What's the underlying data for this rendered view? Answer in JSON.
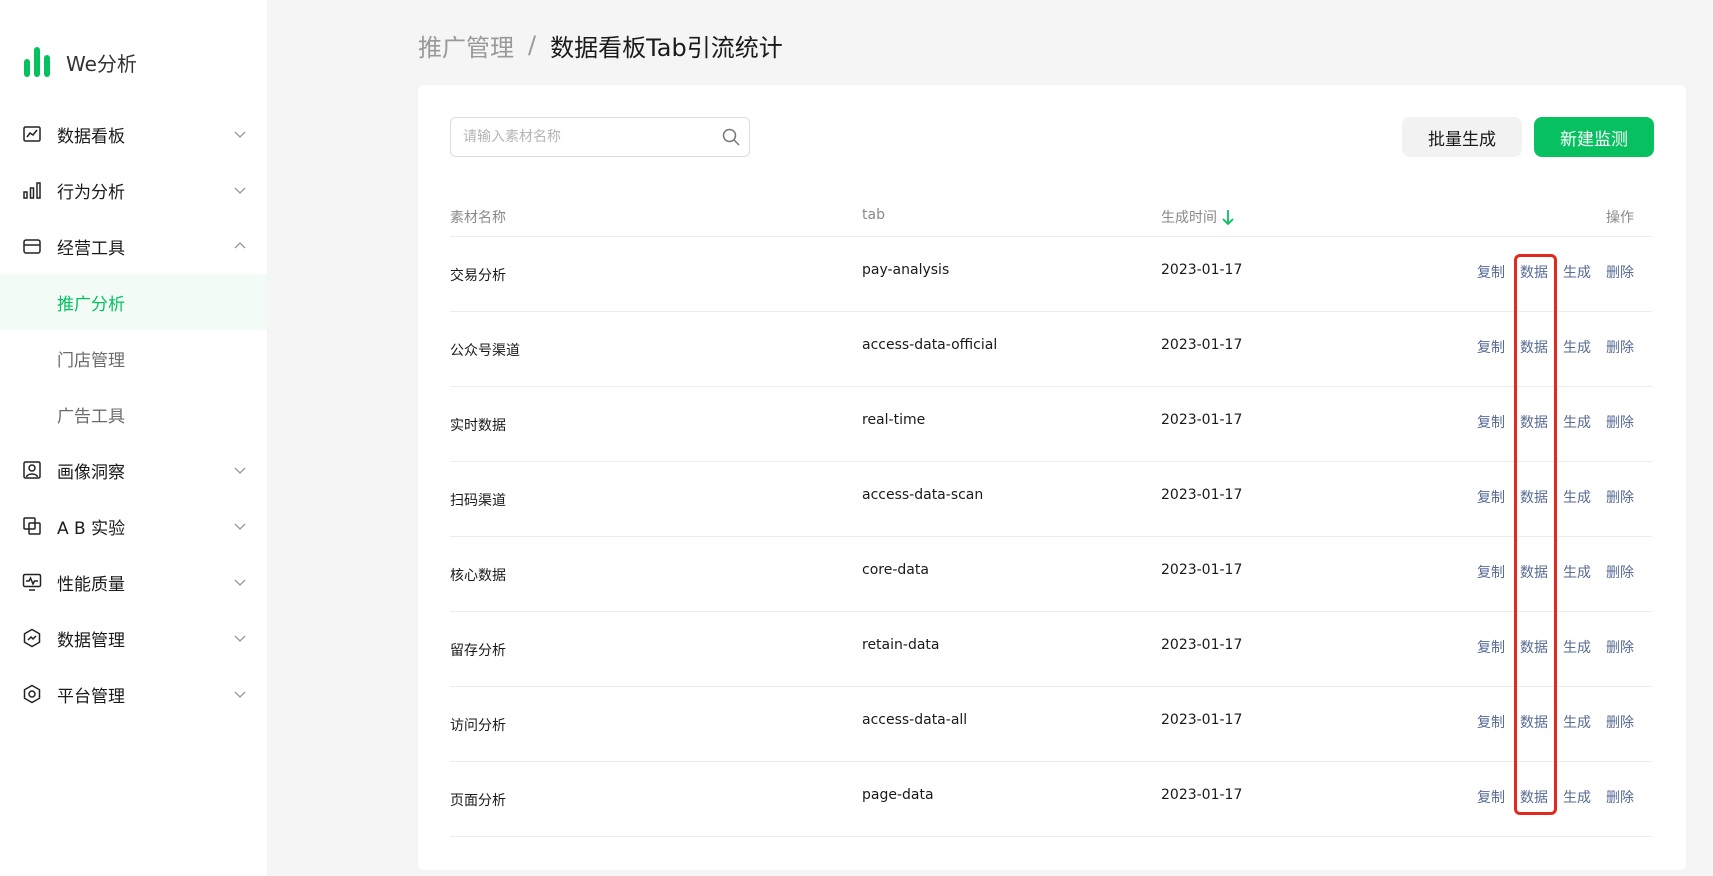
{
  "app": {
    "name": "We分析",
    "brand_color": "#07c160"
  },
  "sidebar": {
    "items": [
      {
        "label": "数据看板",
        "icon": "chart-board-icon",
        "expanded": false
      },
      {
        "label": "行为分析",
        "icon": "bar-chart-icon",
        "expanded": false
      },
      {
        "label": "经营工具",
        "icon": "store-icon",
        "expanded": true,
        "children": [
          {
            "label": "推广分析",
            "active": true
          },
          {
            "label": "门店管理",
            "active": false
          },
          {
            "label": "广告工具",
            "active": false
          }
        ]
      },
      {
        "label": "画像洞察",
        "icon": "portrait-icon",
        "expanded": false
      },
      {
        "label": "A B 实验",
        "icon": "ab-test-icon",
        "expanded": false
      },
      {
        "label": "性能质量",
        "icon": "monitor-icon",
        "expanded": false
      },
      {
        "label": "数据管理",
        "icon": "data-manage-icon",
        "expanded": false
      },
      {
        "label": "平台管理",
        "icon": "platform-gear-icon",
        "expanded": false
      }
    ]
  },
  "breadcrumb": {
    "parent": "推广管理",
    "separator": "/",
    "current": "数据看板Tab引流统计"
  },
  "toolbar": {
    "search_placeholder": "请输入素材名称",
    "batch_label": "批量生成",
    "new_label": "新建监测"
  },
  "table": {
    "headers": {
      "name": "素材名称",
      "tab": "tab",
      "time": "生成时间",
      "ops": "操作"
    },
    "sort": {
      "column": "time",
      "direction": "desc"
    },
    "actions": {
      "copy": "复制",
      "data": "数据",
      "generate": "生成",
      "delete": "删除"
    },
    "rows": [
      {
        "name": "交易分析",
        "tab": "pay-analysis",
        "time": "2023-01-17"
      },
      {
        "name": "公众号渠道",
        "tab": "access-data-official",
        "time": "2023-01-17"
      },
      {
        "name": "实时数据",
        "tab": "real-time",
        "time": "2023-01-17"
      },
      {
        "name": "扫码渠道",
        "tab": "access-data-scan",
        "time": "2023-01-17"
      },
      {
        "name": "核心数据",
        "tab": "core-data",
        "time": "2023-01-17"
      },
      {
        "name": "留存分析",
        "tab": "retain-data",
        "time": "2023-01-17"
      },
      {
        "name": "访问分析",
        "tab": "access-data-all",
        "time": "2023-01-17"
      },
      {
        "name": "页面分析",
        "tab": "page-data",
        "time": "2023-01-17"
      }
    ]
  },
  "colors": {
    "link": "#576b95",
    "highlight": "#e02a1f",
    "active_bg": "#f2fbf6"
  }
}
